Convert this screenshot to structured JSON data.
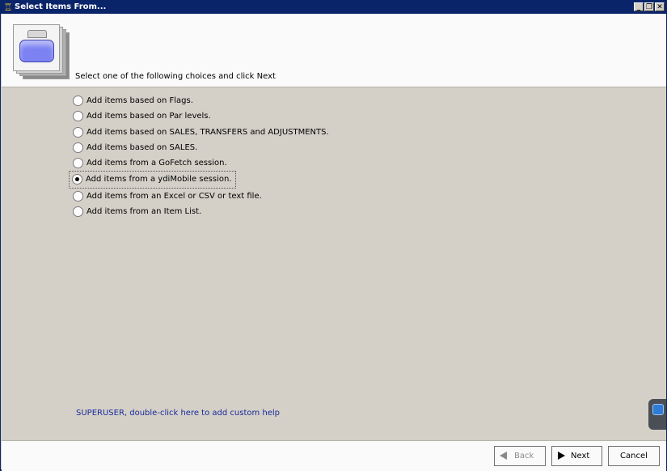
{
  "window": {
    "title": "Select Items From...",
    "controls": {
      "minimize": "_",
      "maximize": "❐",
      "close": "✕"
    }
  },
  "header": {
    "instruction": "Select one of the following choices and click Next",
    "graphic_icon": "handheld-device-icon"
  },
  "choices": [
    {
      "label": "Add items based on Flags.",
      "selected": false
    },
    {
      "label": "Add items based on Par levels.",
      "selected": false
    },
    {
      "label": "Add items based on SALES, TRANSFERS and ADJUSTMENTS.",
      "selected": false
    },
    {
      "label": "Add items based on SALES.",
      "selected": false
    },
    {
      "label": "Add items from a GoFetch session.",
      "selected": false
    },
    {
      "label": "Add items from a ydiMobile session.",
      "selected": true
    },
    {
      "label": "Add items from an Excel or CSV or text file.",
      "selected": false
    },
    {
      "label": "Add items from an Item List.",
      "selected": false
    }
  ],
  "help": {
    "text": "SUPERUSER, double-click here to add custom help"
  },
  "buttons": {
    "back": "Back",
    "next": "Next",
    "cancel": "Cancel"
  },
  "colors": {
    "titlebar": "#0a246a",
    "body": "#d4d0c8",
    "header": "#fafafa",
    "help_link": "#1a2b9a"
  }
}
